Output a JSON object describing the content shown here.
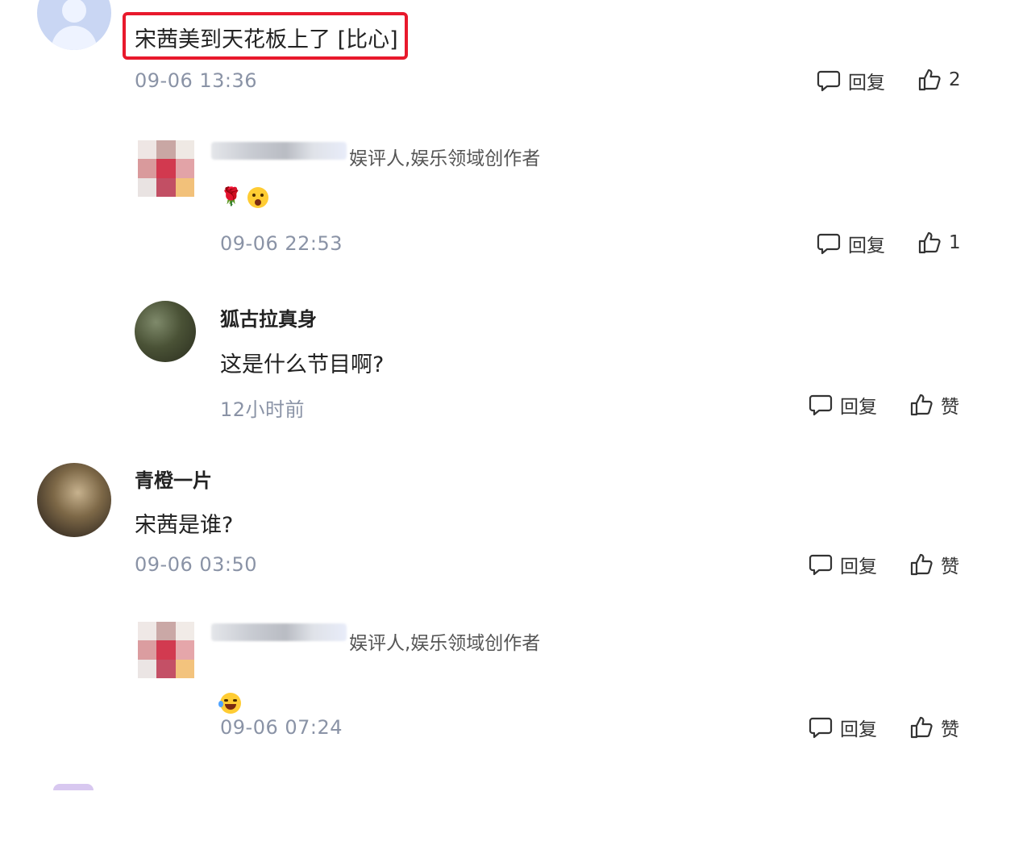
{
  "comments": [
    {
      "text": "宋茜美到天花板上了 [比心]",
      "time": "09-06 13:36",
      "reply_label": "回复",
      "like_label": "2"
    },
    {
      "role": "娱评人,娱乐领域创作者",
      "emoji": "🌹",
      "time": "09-06 22:53",
      "reply_label": "回复",
      "like_label": "1"
    },
    {
      "username": "狐古拉真身",
      "text": "这是什么节目啊?",
      "time": "12小时前",
      "reply_label": "回复",
      "like_label": "赞"
    },
    {
      "username": "青橙一片",
      "text": "宋茜是谁?",
      "time": "09-06 03:50",
      "reply_label": "回复",
      "like_label": "赞"
    },
    {
      "role": "娱评人,娱乐领域创作者",
      "time": "09-06 07:24",
      "reply_label": "回复",
      "like_label": "赞"
    }
  ],
  "colors": {
    "highlight": "#e8192c",
    "timestamp": "#8a93a6"
  },
  "icons": {
    "reply": "speech-bubble-icon",
    "like": "thumbs-up-icon"
  }
}
